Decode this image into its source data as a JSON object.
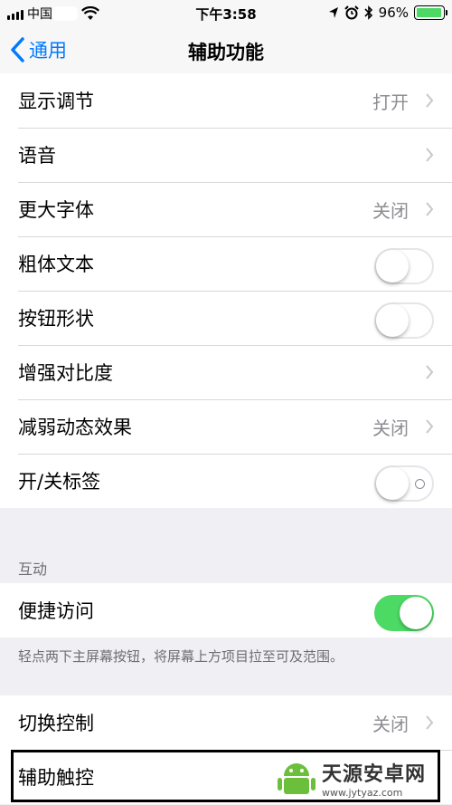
{
  "status": {
    "carrier": "中国",
    "time": "下午3:58",
    "battery": "96%",
    "battery_level": 0.96,
    "battery_color": "#4cd964"
  },
  "nav": {
    "back_label": "通用",
    "title": "辅助功能",
    "accent": "#007aff"
  },
  "rows_top": [
    {
      "label": "显示调节",
      "value": "打开",
      "control": "chevron"
    },
    {
      "label": "语音",
      "value": "",
      "control": "chevron"
    },
    {
      "label": "更大字体",
      "value": "关闭",
      "control": "chevron"
    },
    {
      "label": "粗体文本",
      "control": "toggle",
      "on": false
    },
    {
      "label": "按钮形状",
      "control": "toggle",
      "on": false
    },
    {
      "label": "增强对比度",
      "value": "",
      "control": "chevron"
    },
    {
      "label": "减弱动态效果",
      "value": "关闭",
      "control": "chevron"
    },
    {
      "label": "开/关标签",
      "control": "toggle",
      "on": false,
      "labels": true
    }
  ],
  "interaction": {
    "section_header": "互动",
    "reachability_label": "便捷访问",
    "reachability_on": true,
    "footer": "轻点两下主屏幕按钮，将屏幕上方项目拉至可及范围。"
  },
  "rows_bottom": [
    {
      "label": "切换控制",
      "value": "关闭",
      "control": "chevron"
    },
    {
      "label": "辅助触控",
      "value": "",
      "control": "chevron"
    }
  ],
  "watermark": {
    "main": "天源安卓网",
    "url": "www.jytyaz.com"
  }
}
